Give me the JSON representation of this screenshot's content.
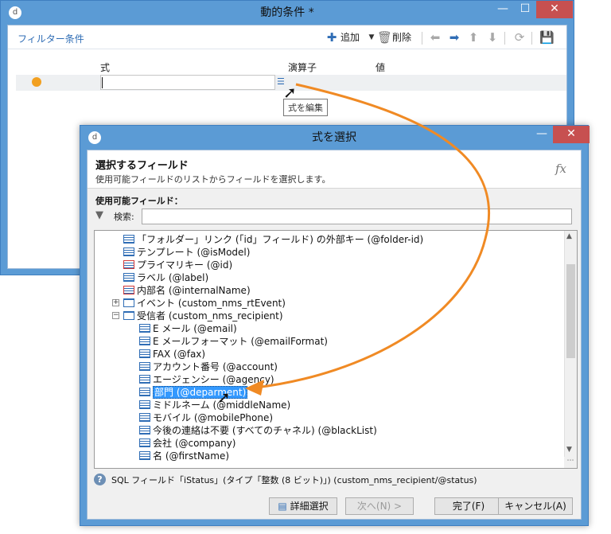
{
  "window1": {
    "title": "動的条件 *",
    "filter_label": "フィルター条件",
    "toolbar": {
      "add_label": "追加",
      "delete_label": "削除"
    },
    "columns": {
      "expression": "式",
      "operator": "演算子",
      "value": "値"
    },
    "tooltip": "式を編集"
  },
  "window2": {
    "title": "式を選択",
    "heading": "選択するフィールド",
    "subheading": "使用可能フィールドのリストからフィールドを選択します。",
    "fx_label": "fx",
    "available_label": "使用可能フィールド：",
    "search_label": "検索:",
    "search_value": "",
    "tree": [
      {
        "label": "「フォルダー」リンク (「id」フィールド) の外部キー (@folder-id)",
        "icon": "link-field-icon"
      },
      {
        "label": "テンプレート (@isModel)",
        "icon": "field-icon"
      },
      {
        "label": "プライマリキー (@id)",
        "icon": "key-field-icon"
      },
      {
        "label": "ラベル (@label)",
        "icon": "field-icon"
      },
      {
        "label": "内部名 (@internalName)",
        "icon": "key-field-icon"
      },
      {
        "label": "イベント (custom_nms_rtEvent)",
        "icon": "table-icon",
        "expander": "+"
      },
      {
        "label": "受信者 (custom_nms_recipient)",
        "icon": "table-icon",
        "expander": "−"
      },
      {
        "label": "E メール (@email)",
        "icon": "field-icon"
      },
      {
        "label": "E メールフォーマット (@emailFormat)",
        "icon": "field-icon"
      },
      {
        "label": "FAX (@fax)",
        "icon": "field-icon"
      },
      {
        "label": "アカウント番号 (@account)",
        "icon": "field-icon"
      },
      {
        "label": "エージェンシー (@agency)",
        "icon": "field-icon"
      },
      {
        "label": "部門 (@deparment)",
        "icon": "field-icon",
        "selected": true
      },
      {
        "label": "ミドルネーム (@middleName)",
        "icon": "field-icon"
      },
      {
        "label": "モバイル (@mobilePhone)",
        "icon": "field-icon"
      },
      {
        "label": "今後の連絡は不要 (すべてのチャネル) (@blackList)",
        "icon": "field-icon"
      },
      {
        "label": "会社 (@company)",
        "icon": "field-icon"
      },
      {
        "label": "名 (@firstName)",
        "icon": "field-icon"
      }
    ],
    "info_text": "SQL フィールド「iStatus」(タイプ「整数 (8 ビット)」) (custom_nms_recipient/@status)",
    "buttons": {
      "advanced": "詳細選択",
      "next": "次へ(N) >",
      "finish": "完了(F)",
      "cancel": "キャンセル(A)"
    }
  },
  "colors": {
    "accent": "#f08a24",
    "titlebar": "#5b9bd5",
    "selection": "#3399ff",
    "close_button": "#c75050",
    "condition_dot": "#f2a021"
  }
}
